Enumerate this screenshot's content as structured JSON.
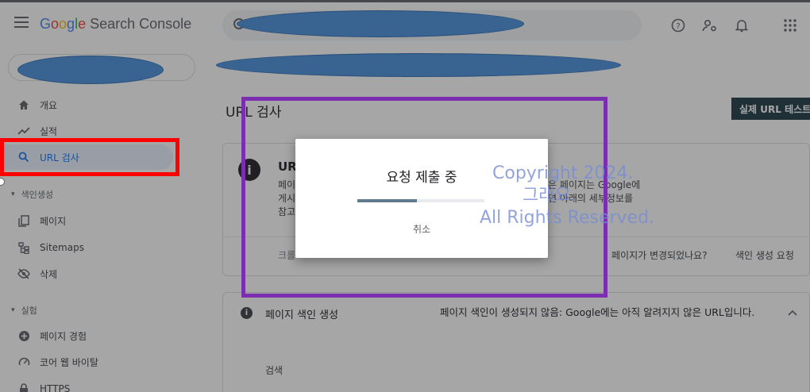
{
  "app": {
    "logo_parts": [
      "G",
      "o",
      "o",
      "g",
      "l",
      "e"
    ],
    "logo_rest": " Search Console"
  },
  "icons": {
    "menu": "hamburger-menu-icon",
    "help": "help-icon",
    "admin": "manage-accounts-icon",
    "notifications": "bell-icon",
    "apps": "apps-grid-icon"
  },
  "sidebar": {
    "items": [
      {
        "label": "개요",
        "icon": "home-icon"
      },
      {
        "label": "실적",
        "icon": "trending-up-icon"
      },
      {
        "label": "URL 검사",
        "icon": "search-icon"
      }
    ],
    "section_index": "색인생성",
    "index_items": [
      {
        "label": "페이지",
        "icon": "pages-icon"
      },
      {
        "label": "Sitemaps",
        "icon": "sitemap-icon"
      },
      {
        "label": "삭제",
        "icon": "visibility-off-icon"
      }
    ],
    "section_experience": "실험",
    "experience_items": [
      {
        "label": "페이지 경험",
        "icon": "add-circle-icon"
      },
      {
        "label": "코어 웹 바이탈",
        "icon": "speed-icon"
      },
      {
        "label": "HTTPS",
        "icon": "lock-icon"
      }
    ]
  },
  "main": {
    "page_title": "URL 검사",
    "live_test_button": "실제 URL 테스트",
    "card1": {
      "title_fragment": "UR",
      "desc_line1_left": "페이",
      "desc_line1_right": "은 페이지는 Google에",
      "desc_line2_left": "게시",
      "desc_line2_right": "면 아래의 세부정보를",
      "desc_line3_left": "참고",
      "crawl_label": "크롤",
      "changed_question": "페이지가 변경되었나요?",
      "request_indexing": "색인 생성 요청"
    },
    "card2": {
      "label": "페이지 색인 생성",
      "status": "페이지 색인이 생성되지 않음: Google에는 아직 알려지지 않은 URL입니다.",
      "search_label": "검색"
    }
  },
  "dialog": {
    "title": "요청 제출 중",
    "progress": 0.47,
    "cancel": "취소"
  },
  "watermark": {
    "line1": "Copyright 2024.",
    "line2": "그래요.",
    "line3": "All Rights Reserved."
  },
  "colors": {
    "accent": "#1a73e8",
    "annotation_red": "#ff0000",
    "annotation_purple": "#7b2fb0",
    "redaction": "#4a90d9"
  }
}
